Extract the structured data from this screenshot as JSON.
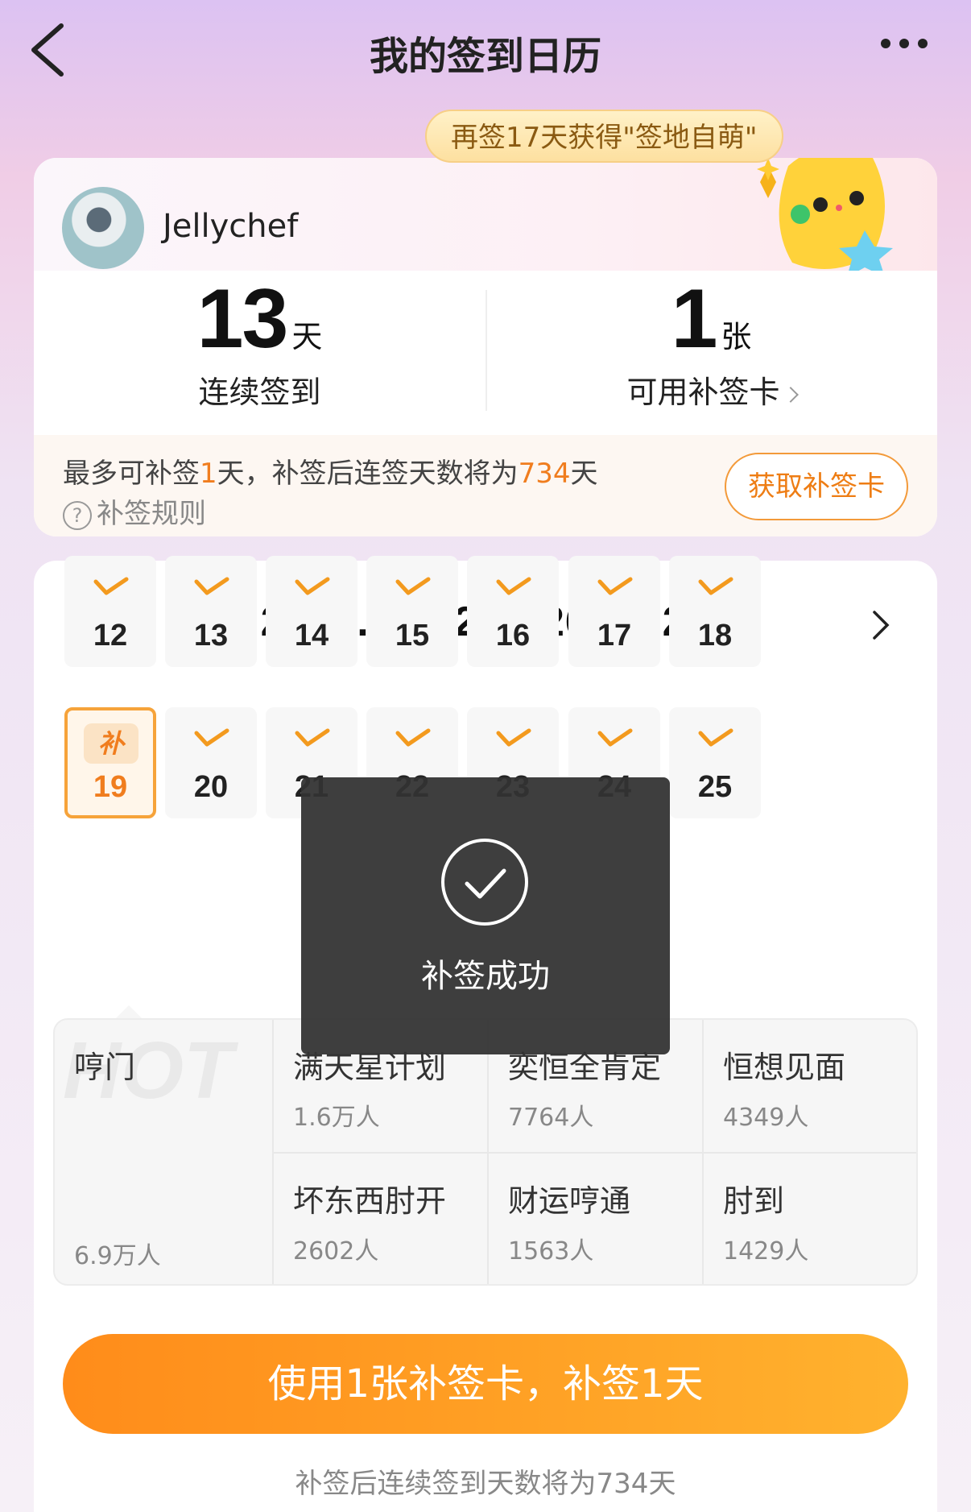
{
  "header": {
    "title": "我的签到日历",
    "back_icon": "back-arrow-icon",
    "more_icon": "more-dots-icon"
  },
  "promo": {
    "text": "再签17天获得\"签地自萌\""
  },
  "user": {
    "name": "Jellychef"
  },
  "stats": {
    "streak": {
      "value": "13",
      "unit": "天",
      "label": "连续签到"
    },
    "cards": {
      "value": "1",
      "unit": "张",
      "label": "可用补签卡"
    }
  },
  "makeup": {
    "text_a": "最多可补签",
    "text_b": "1",
    "text_c": "天，补签后连签天数将为",
    "text_d": "734",
    "text_e": "天",
    "rule_label": "补签规则",
    "get_card_label": "获取补签卡"
  },
  "calendar": {
    "range": "2026.07.12-2026.07.25",
    "days": [
      {
        "num": "12",
        "checked": true
      },
      {
        "num": "13",
        "checked": true
      },
      {
        "num": "14",
        "checked": true
      },
      {
        "num": "15",
        "checked": true
      },
      {
        "num": "16",
        "checked": true
      },
      {
        "num": "17",
        "checked": true
      },
      {
        "num": "18",
        "checked": true
      },
      {
        "num": "19",
        "checked": false,
        "badge": "补",
        "selected": true
      },
      {
        "num": "20",
        "checked": true
      },
      {
        "num": "21",
        "checked": true
      },
      {
        "num": "22",
        "checked": true
      },
      {
        "num": "23",
        "checked": true
      },
      {
        "num": "24",
        "checked": true
      },
      {
        "num": "25",
        "checked": true
      }
    ]
  },
  "hot": {
    "watermark": "HOT",
    "first": {
      "title": "哼门",
      "count": "6.9万人"
    },
    "cells": [
      {
        "title": "满天星计划",
        "count": "1.6万人"
      },
      {
        "title": "奕恒全肯定",
        "count": "7764人"
      },
      {
        "title": "恒想见面",
        "count": "4349人"
      },
      {
        "title": "坏东西肘开",
        "count": "2602人"
      },
      {
        "title": "财运哼通",
        "count": "1563人"
      },
      {
        "title": "肘到",
        "count": "1429人"
      }
    ]
  },
  "action": {
    "button_label": "使用1张补签卡，补签1天",
    "hint": "补签后连续签到天数将为734天"
  },
  "toast": {
    "text": "补签成功"
  },
  "colors": {
    "accent": "#f07d1e",
    "check": "#f39a1e",
    "button_start": "#ff8c1a",
    "button_end": "#ffb22e"
  }
}
